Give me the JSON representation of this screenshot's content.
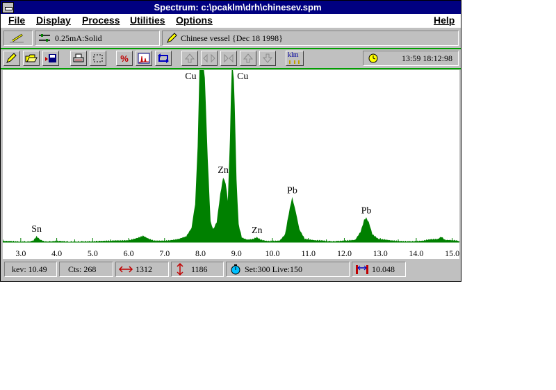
{
  "window": {
    "title": "Spectrum: c:\\pcaklm\\drh\\chinesev.spm"
  },
  "menu": {
    "file": "File",
    "display": "Display",
    "process": "Process",
    "utilities": "Utilities",
    "options": "Options",
    "help": "Help"
  },
  "info": {
    "beam": "0.25mA:Solid",
    "sample": "Chinese vessel {Dec 18 1998}"
  },
  "toolbar": {
    "percent": "%",
    "klm": "klm",
    "time": "13:59  18:12:98"
  },
  "chart_data": {
    "type": "area",
    "xlabel": "",
    "ylabel": "",
    "xlim": [
      2.5,
      15.2
    ],
    "x_ticks": [
      "3.0",
      "4.0",
      "5.0",
      "6.0",
      "7.0",
      "8.0",
      "9.0",
      "10.0",
      "11.0",
      "12.0",
      "13.0",
      "14.0",
      "15.0"
    ],
    "peaks": [
      {
        "label": "Sn",
        "energy": 3.44
      },
      {
        "label": "Cu",
        "energy": 8.04
      },
      {
        "label": "Zn",
        "energy": 8.63
      },
      {
        "label": "Cu",
        "energy": 8.9
      },
      {
        "label": "Zn",
        "energy": 9.57
      },
      {
        "label": "Pb",
        "energy": 10.55
      },
      {
        "label": "Pb",
        "energy": 12.61
      }
    ],
    "series": [
      {
        "values_x": [
          2.5,
          3.2,
          3.35,
          3.44,
          3.55,
          3.7,
          4.5,
          5.0,
          6.0,
          6.2,
          6.4,
          6.55,
          6.7,
          7.0,
          7.4,
          7.6,
          7.75,
          7.85,
          7.92,
          7.97,
          8.04,
          8.12,
          8.2,
          8.28,
          8.35,
          8.45,
          8.55,
          8.63,
          8.7,
          8.76,
          8.82,
          8.87,
          8.9,
          8.95,
          9.0,
          9.06,
          9.15,
          9.3,
          9.45,
          9.57,
          9.7,
          9.9,
          10.2,
          10.35,
          10.45,
          10.55,
          10.65,
          10.75,
          10.9,
          11.2,
          11.8,
          12.3,
          12.45,
          12.55,
          12.61,
          12.68,
          12.78,
          12.95,
          13.3,
          14.2,
          14.6,
          14.7,
          14.8,
          15.2
        ],
        "values_y": [
          1,
          1,
          3,
          9,
          4,
          1,
          1,
          1,
          2,
          6,
          10,
          6,
          3,
          3,
          4,
          8,
          20,
          55,
          140,
          250,
          270,
          240,
          120,
          30,
          18,
          30,
          70,
          95,
          85,
          60,
          150,
          270,
          275,
          200,
          90,
          25,
          6,
          3,
          4,
          7,
          4,
          2,
          3,
          12,
          40,
          65,
          45,
          18,
          4,
          2,
          2,
          3,
          15,
          33,
          36,
          28,
          12,
          4,
          2,
          2,
          5,
          7,
          4,
          1
        ]
      }
    ]
  },
  "status": {
    "kev": "kev: 10.49",
    "cts": "Cts: 268",
    "width": "1312",
    "height": "1186",
    "set_live": "Set:300 Live:150",
    "value": "10.048"
  },
  "colors": {
    "title_bar": "#000080",
    "spectrum": "#008000",
    "accent_line": "#00a000"
  }
}
